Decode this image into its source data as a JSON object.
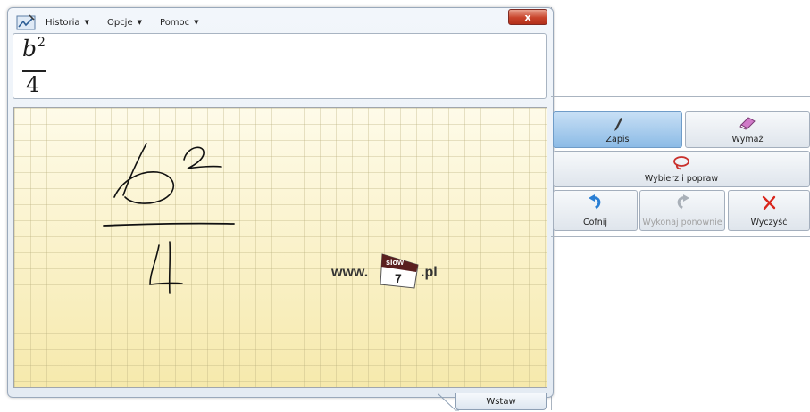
{
  "menu": {
    "items": [
      {
        "label": "Historia"
      },
      {
        "label": "Opcje"
      },
      {
        "label": "Pomoc"
      }
    ],
    "close_glyph": "x"
  },
  "preview": {
    "numerator_base": "b",
    "numerator_exponent": "2",
    "denominator": "4"
  },
  "watermark": {
    "prefix": "www.",
    "badge_top": "slow",
    "badge_number": "7",
    "suffix": ".pl"
  },
  "toolbar": {
    "write_label": "Zapis",
    "erase_label": "Wymaż",
    "select_label": "Wybierz i popraw",
    "undo_label": "Cofnij",
    "redo_label": "Wykonaj ponownie",
    "clear_label": "Wyczyść"
  },
  "insert_button": {
    "label": "Wstaw"
  },
  "icons": {
    "app": "math-input-icon",
    "write": "pen-icon",
    "erase": "eraser-icon",
    "select": "lasso-icon",
    "undo": "undo-arrow-icon",
    "redo": "redo-arrow-icon",
    "clear": "red-x-icon"
  },
  "colors": {
    "active_button": "#8cbbe6",
    "canvas": "#fdf7d8",
    "close_button": "#c8442b",
    "undo_icon": "#2a7fd4",
    "clear_icon": "#d9261c"
  }
}
